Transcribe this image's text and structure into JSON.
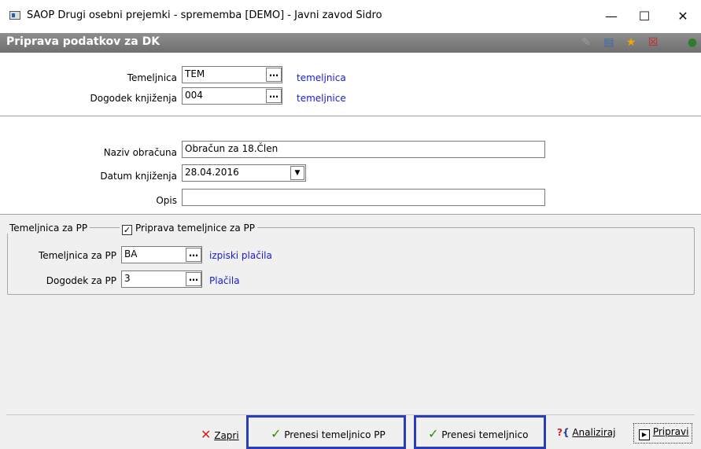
{
  "window": {
    "title": "SAOP  Drugi osebni prejemki  - sprememba [DEMO] - Javni zavod Sidro",
    "minimize": "—",
    "maximize": "☐",
    "close": "✕"
  },
  "header": {
    "title": "Priprava podatkov za DK",
    "toolbar_icons": [
      "edit-icon",
      "columns-icon",
      "star-icon",
      "delete-icon",
      "globe-icon"
    ]
  },
  "booking": {
    "temeljnica_label": "Temeljnica",
    "temeljnica_value": "TEM",
    "temeljnica_desc": "temeljnica",
    "dogodek_label": "Dogodek knjiženja",
    "dogodek_value": "004",
    "dogodek_desc": "temeljnice",
    "lookup": "…"
  },
  "details": {
    "naziv_label": "Naziv obračuna",
    "naziv_value": "Obračun za 18.Člen",
    "datum_label": "Datum knjiženja",
    "datum_value": "28.04.2016",
    "dropdown": "▼",
    "opis_label": "Opis",
    "opis_value": ""
  },
  "pp_group": {
    "legend": "Temeljnica za PP",
    "checkbox_label": "Priprava temeljnice za PP",
    "checkbox_checked": true,
    "checkmark": "✓",
    "temeljnica_label": "Temeljnica za PP",
    "temeljnica_value": "BA",
    "temeljnica_desc": "izpiski plačila",
    "dogodek_label": "Dogodek za PP",
    "dogodek_value": "3",
    "dogodek_desc": "Plačila"
  },
  "footer": {
    "zapri": "Zapri",
    "prenesi_pp": "Prenesi temeljnico PP",
    "prenesi": "Prenesi temeljnico",
    "analiziraj": "Analiziraj",
    "pripravi": "Pripravi"
  },
  "colors": {
    "highlight": "#2a3db8",
    "link": "#1a1acc",
    "check": "#2e8b00",
    "close_x": "#cc2222"
  }
}
